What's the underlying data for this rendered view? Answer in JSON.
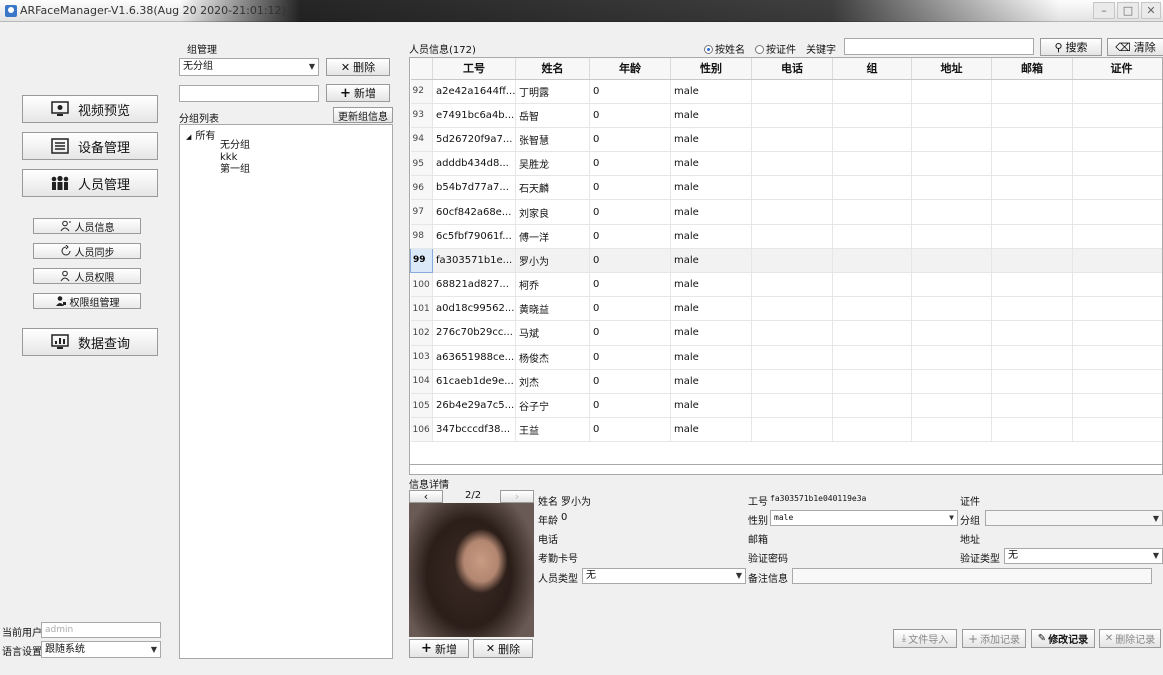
{
  "window": {
    "title": "ARFaceManager-V1.6.38(Aug 20 2020-21:01:12)"
  },
  "nav": {
    "items": [
      {
        "label": "视频预览",
        "icon": "monitor-icon"
      },
      {
        "label": "设备管理",
        "icon": "device-list-icon"
      },
      {
        "label": "人员管理",
        "icon": "people-group-icon"
      },
      {
        "label": "数据查询",
        "icon": "chart-monitor-icon"
      }
    ],
    "sub_items": [
      {
        "label": "人员信息",
        "icon": "person-info-icon"
      },
      {
        "label": "人员同步",
        "icon": "sync-icon"
      },
      {
        "label": "人员权限",
        "icon": "person-permission-icon"
      },
      {
        "label": "权限组管理",
        "icon": "permission-group-icon"
      }
    ]
  },
  "footer": {
    "current_user_label": "当前用户",
    "current_user_value": "admin",
    "language_label": "语言设置",
    "language_value": "跟随系统"
  },
  "group_panel": {
    "title": "组管理",
    "group_select": "无分组",
    "delete_label": "删除",
    "add_label": "新增",
    "list_label": "分组列表",
    "update_label": "更新组信息",
    "tree_root": "所有",
    "tree_children": [
      "无分组",
      "kkk",
      "第一组"
    ]
  },
  "people": {
    "header_label": "人员信息(172)",
    "search_mode_name": "按姓名",
    "search_mode_id": "按证件",
    "keyword_label": "关键字",
    "search_button": "搜索",
    "clear_button": "清除",
    "columns": [
      "工号",
      "姓名",
      "年龄",
      "性别",
      "电话",
      "组",
      "地址",
      "邮箱",
      "证件"
    ],
    "rows": [
      {
        "n": "92",
        "id": "a2e42a1644ff...",
        "name": "丁明露",
        "age": "0",
        "sex": "male"
      },
      {
        "n": "93",
        "id": "e7491bc6a4b...",
        "name": "岳智",
        "age": "0",
        "sex": "male"
      },
      {
        "n": "94",
        "id": "5d26720f9a7...",
        "name": "张智慧",
        "age": "0",
        "sex": "male"
      },
      {
        "n": "95",
        "id": "adddb434d8...",
        "name": "吴胜龙",
        "age": "0",
        "sex": "male"
      },
      {
        "n": "96",
        "id": "b54b7d77a7...",
        "name": "石天麟",
        "age": "0",
        "sex": "male"
      },
      {
        "n": "97",
        "id": "60cf842a68e...",
        "name": "刘家良",
        "age": "0",
        "sex": "male"
      },
      {
        "n": "98",
        "id": "6c5fbf79061f...",
        "name": "傅一洋",
        "age": "0",
        "sex": "male"
      },
      {
        "n": "99",
        "id": "fa303571b1e...",
        "name": "罗小为",
        "age": "0",
        "sex": "male"
      },
      {
        "n": "100",
        "id": "68821ad827...",
        "name": "柯乔",
        "age": "0",
        "sex": "male"
      },
      {
        "n": "101",
        "id": "a0d18c99562...",
        "name": "黄晓益",
        "age": "0",
        "sex": "male"
      },
      {
        "n": "102",
        "id": "276c70b29cc...",
        "name": "马斌",
        "age": "0",
        "sex": "male"
      },
      {
        "n": "103",
        "id": "a63651988ce...",
        "name": "杨俊杰",
        "age": "0",
        "sex": "male"
      },
      {
        "n": "104",
        "id": "61caeb1de9e...",
        "name": "刘杰",
        "age": "0",
        "sex": "male"
      },
      {
        "n": "105",
        "id": "26b4e29a7c5...",
        "name": "谷子宁",
        "age": "0",
        "sex": "male"
      },
      {
        "n": "106",
        "id": "347bcccdf38...",
        "name": "王益",
        "age": "0",
        "sex": "male"
      }
    ],
    "selected_row": "99"
  },
  "detail": {
    "header": "信息详情",
    "page": "2/2",
    "name_label": "姓名",
    "name_value": "罗小为",
    "age_label": "年龄",
    "age_value": "0",
    "phone_label": "电话",
    "card_label": "考勤卡号",
    "type_label": "人员类型",
    "type_value": "无",
    "empno_label": "工号",
    "empno_value": "fa303571b1e040119e3a",
    "sex_label": "性别",
    "sex_value": "male",
    "email_label": "邮箱",
    "pwd_label": "验证密码",
    "note_label": "备注信息",
    "cert_label": "证件",
    "group_label": "分组",
    "addr_label": "地址",
    "verify_label": "验证类型",
    "verify_value": "无",
    "add_button": "新增",
    "delete_button": "删除",
    "import_button": "文件导入",
    "add_record_button": "添加记录",
    "edit_record_button": "修改记录",
    "delete_record_button": "删除记录"
  }
}
